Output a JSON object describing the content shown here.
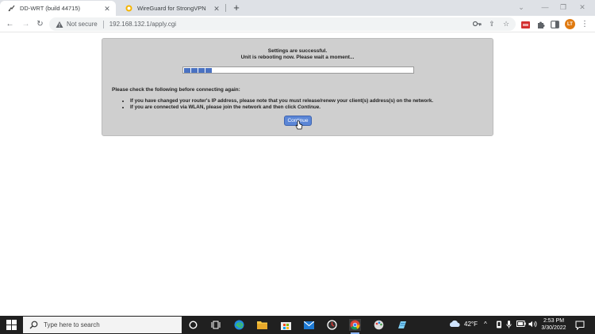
{
  "browser": {
    "tabs": [
      {
        "title": "DD-WRT (build 44715)",
        "active": true
      },
      {
        "title": "WireGuard for StrongVPN",
        "active": false
      }
    ],
    "security_label": "Not secure",
    "url": "192.168.132.1/apply.cgi",
    "avatar_initials": "LT"
  },
  "page": {
    "status_line1": "Settings are successful.",
    "status_line2": "Unit is rebooting now. Please wait a moment...",
    "progress_percent": 13,
    "check_heading": "Please check the following before connecting again:",
    "bullet1": "If you have changed your router's IP address, please note that you must release/renew your client(s) address(s) on the network.",
    "bullet2_prefix": "If you are connected via WLAN, please join the network and then click ",
    "bullet2_emphasis": "Continue",
    "bullet2_suffix": ".",
    "continue_label": "Continue"
  },
  "taskbar": {
    "search_placeholder": "Type here to search",
    "weather": "42°F",
    "time": "2:53 PM",
    "date": "3/30/2022"
  },
  "colors": {
    "panel_bg": "#cfcfcf",
    "progress_fill": "#4a72c2",
    "button_bg": "#5b86d6",
    "taskbar_bg": "#202020",
    "avatar_bg": "#e07a10"
  }
}
